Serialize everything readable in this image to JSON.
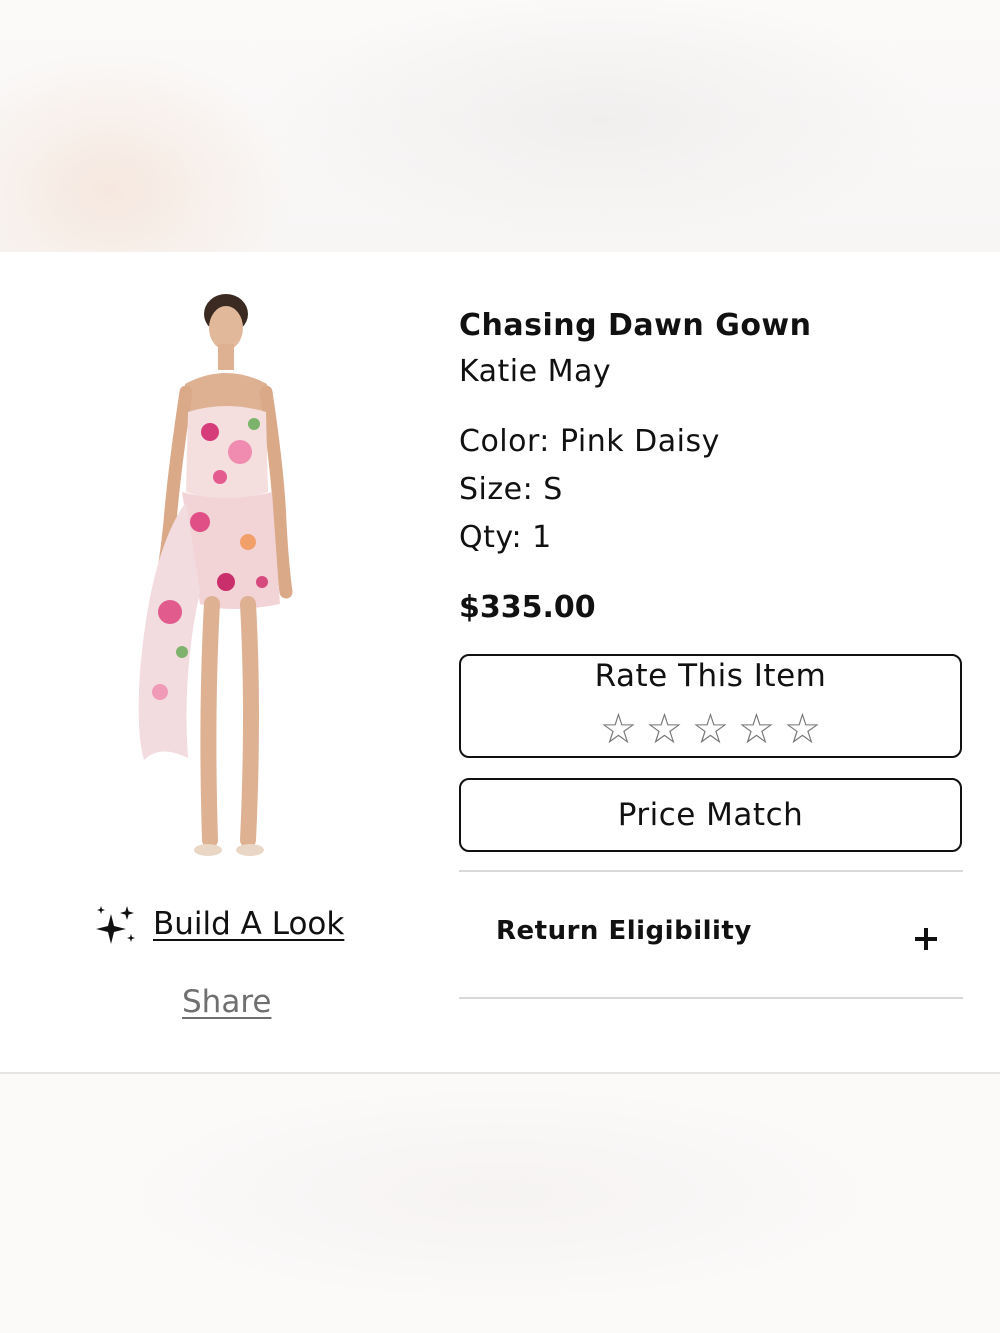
{
  "product": {
    "image_alt": "Chasing Dawn Gown",
    "title": "Chasing Dawn Gown",
    "brand": "Katie May",
    "color": "Color: Pink Daisy",
    "size": "Size: S",
    "qty": "Qty: 1",
    "price": "$335.00"
  },
  "actions": {
    "build_look_label": "Build A Look",
    "share_label": "Share",
    "rate_title": "Rate This Item",
    "rating": {
      "value": 0,
      "max": 5,
      "star_glyph": "☆"
    },
    "price_match_label": "Price Match"
  },
  "accordion": {
    "return_label": "Return Eligibility",
    "toggle_icon": "plus-icon"
  },
  "colors": {
    "text": "#111111",
    "muted": "#6f6f6f",
    "divider": "#d9d9d9"
  }
}
